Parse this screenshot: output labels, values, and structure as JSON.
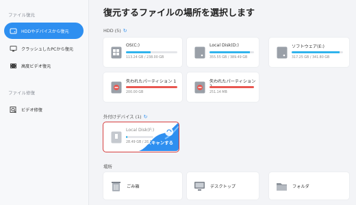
{
  "sidebar": {
    "section_recovery": "ファイル復元",
    "items": [
      {
        "label": "HDDやデバイスから復元",
        "icon": "drive-icon"
      },
      {
        "label": "クラッシュしたPCから復元",
        "icon": "monitor-icon"
      },
      {
        "label": "高度ビデオ復元",
        "icon": "film-icon"
      }
    ],
    "section_repair": "ファイル修復",
    "repair_items": [
      {
        "label": "ビデオ修復",
        "icon": "video-repair-icon"
      }
    ]
  },
  "main": {
    "title": "復元するファイルの場所を選択します",
    "hdd_section": "HDD (5)",
    "hdd": [
      {
        "name": "OS(C:)",
        "usage": "113.24 GB / 238.00 GB",
        "fill_ratio": 0.48,
        "status": "normal"
      },
      {
        "name": "Local Disk(D:)",
        "usage": "355.55 GB / 389.49 GB",
        "fill_ratio": 0.91,
        "status": "normal"
      },
      {
        "name": "ソフトウェア(E:)",
        "usage": "317.25 GB / 341.80 GB",
        "fill_ratio": 0.93,
        "status": "normal"
      },
      {
        "name": "失われたパーティション 1",
        "usage": "200.00 GB",
        "fill_ratio": 1.0,
        "status": "lost"
      },
      {
        "name": "失われたパーティション 2",
        "usage": "251.14 MB",
        "fill_ratio": 1.0,
        "status": "lost"
      }
    ],
    "external_section": "外付けデバイス (1)",
    "external": [
      {
        "name": "Local Disk(F:)",
        "usage": "28.49 GB / 28.6...",
        "fill_ratio": 0.05,
        "scan_label": "スキャンする"
      }
    ],
    "location_section": "場所",
    "locations": [
      {
        "label": "ごみ箱",
        "icon": "trash-icon"
      },
      {
        "label": "デスクトップ",
        "icon": "desktop-icon"
      },
      {
        "label": "フォルダ",
        "icon": "folder-icon"
      }
    ]
  },
  "colors": {
    "accent": "#2e8ff0",
    "bar_fill": "#2fb3ec",
    "lost": "#e8564f",
    "selected_outline": "#d63c3c"
  }
}
